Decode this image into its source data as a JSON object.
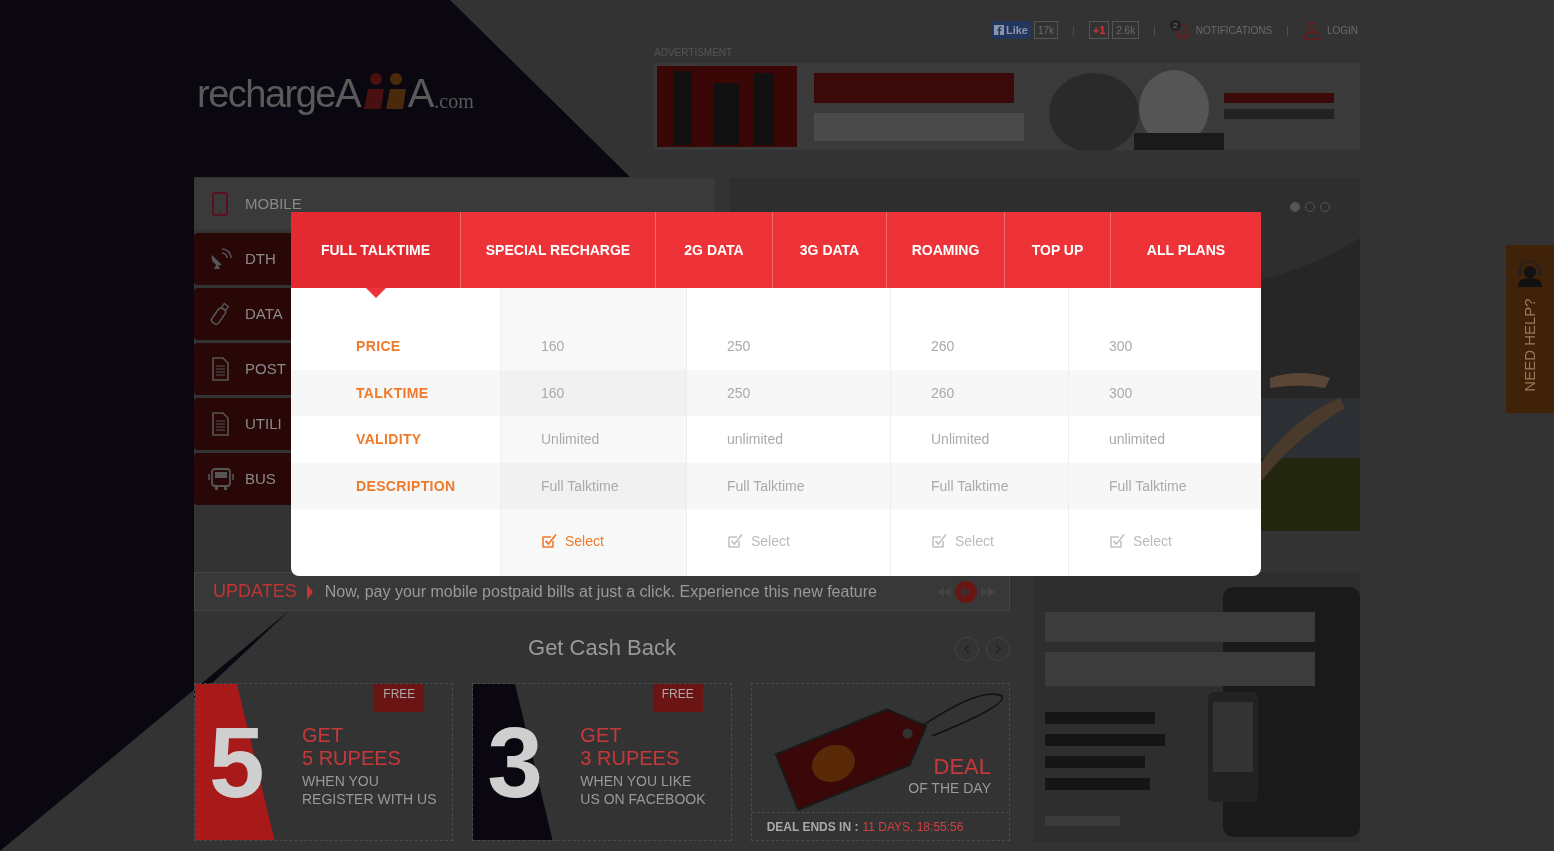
{
  "header": {
    "facebook": {
      "label": "Like",
      "count": "17k"
    },
    "gplus": {
      "label": "+1",
      "count": "2.6k"
    },
    "separators": [
      "|",
      "|",
      "|"
    ],
    "notifications": {
      "badge": "2",
      "label": "NOTIFICATIONS"
    },
    "login": "LOGIN"
  },
  "logo": {
    "start": "recharge",
    "letter_1": "A",
    "letter_2": "A",
    "suffix": ".com"
  },
  "advertisement": {
    "label": "ADVERTISMENT"
  },
  "sidebar": {
    "items": [
      {
        "label": "MOBILE",
        "kind": "phone",
        "selected": true
      },
      {
        "label": "DTH",
        "kind": "dish",
        "selected": false
      },
      {
        "label": "DATA",
        "kind": "usb",
        "selected": false
      },
      {
        "label": "POST",
        "kind": "document",
        "selected": false
      },
      {
        "label": "UTILI",
        "kind": "document",
        "selected": false
      },
      {
        "label": "BUS",
        "kind": "bus",
        "selected": false
      }
    ]
  },
  "slider": {
    "dots": [
      {
        "selected": true
      },
      {
        "selected": false
      },
      {
        "selected": false
      }
    ]
  },
  "updates": {
    "label": "UPDATES",
    "text": "Now, pay your mobile postpaid bills at just a click. Experience this new feature"
  },
  "cashback": {
    "title": "Get Cash Back",
    "cards": [
      {
        "kind": "offer",
        "ribbon": "FREE",
        "number": "5",
        "color": "#a8191a",
        "headline": "GET",
        "amount": "5 RUPEES",
        "caption": [
          "WHEN YOU",
          "REGISTER WITH US"
        ]
      },
      {
        "kind": "offer",
        "ribbon": "FREE",
        "number": "3",
        "color": "#0b0710",
        "headline": "GET",
        "amount": "3 RUPEES",
        "caption": [
          "WHEN YOU LIKE",
          "US ON FACEBOOK"
        ]
      },
      {
        "kind": "deal",
        "title": "DEAL",
        "subtitle": "OF THE DAY",
        "countdown_label": "DEAL ENDS IN :",
        "countdown": "11 DAYS, 18:55:56"
      }
    ]
  },
  "help_tab": {
    "label": "NEED HELP?"
  },
  "plans_modal": {
    "tabs": [
      {
        "label": "FULL TALKTIME",
        "selected": true
      },
      {
        "label": "SPECIAL RECHARGE",
        "selected": false
      },
      {
        "label": "2G DATA",
        "selected": false
      },
      {
        "label": "3G DATA",
        "selected": false
      },
      {
        "label": "ROAMING",
        "selected": false
      },
      {
        "label": "TOP UP",
        "selected": false
      },
      {
        "label": "ALL PLANS",
        "selected": false
      }
    ],
    "row_labels": [
      "PRICE",
      "TALKTIME",
      "VALIDITY",
      "DESCRIPTION"
    ],
    "plans": [
      {
        "price": "160",
        "talktime": "160",
        "validity": "Unlimited",
        "description": "Full Talktime",
        "action": "Select",
        "selected": true
      },
      {
        "price": "250",
        "talktime": "250",
        "validity": "unlimited",
        "description": "Full Talktime",
        "action": "Select",
        "selected": false
      },
      {
        "price": "260",
        "talktime": "260",
        "validity": "Unlimited",
        "description": "Full Talktime",
        "action": "Select",
        "selected": false
      },
      {
        "price": "300",
        "talktime": "300",
        "validity": "unlimited",
        "description": "Full Talktime",
        "action": "Select",
        "selected": false
      }
    ]
  }
}
